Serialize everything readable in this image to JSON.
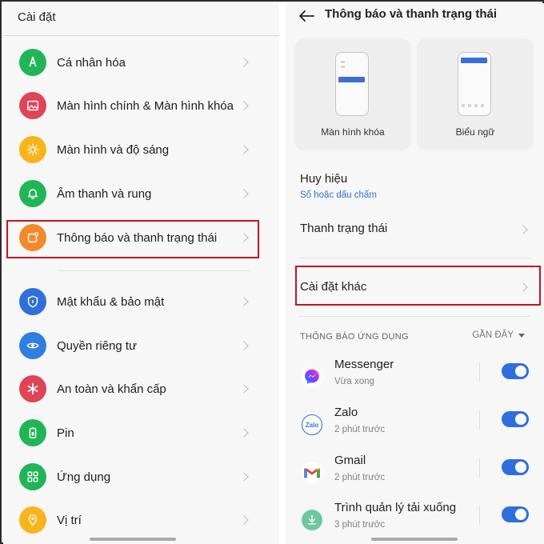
{
  "left": {
    "header": "Cài đặt",
    "items": [
      {
        "label": "Cá nhân hóa",
        "color": "#21b55a",
        "icon": "brush-icon"
      },
      {
        "label": "Màn hình chính & Màn hình khóa",
        "color": "#e04455",
        "icon": "image-icon"
      },
      {
        "label": "Màn hình và độ sáng",
        "color": "#f7b51b",
        "icon": "brightness-icon"
      },
      {
        "label": "Âm thanh và rung",
        "color": "#21b55a",
        "icon": "bell-icon"
      },
      {
        "label": "Thông báo và thanh trạng thái",
        "color": "#f08a2a",
        "icon": "notification-icon"
      },
      {
        "label": "Mật khẩu & bảo mật",
        "color": "#2f6fdb",
        "icon": "shield-icon"
      },
      {
        "label": "Quyền riêng tư",
        "color": "#2f7fe0",
        "icon": "privacy-eye-icon"
      },
      {
        "label": "An toàn và khẩn cấp",
        "color": "#e04455",
        "icon": "emergency-icon"
      },
      {
        "label": "Pin",
        "color": "#21b55a",
        "icon": "battery-icon"
      },
      {
        "label": "Ứng dụng",
        "color": "#21b55a",
        "icon": "apps-grid-icon"
      },
      {
        "label": "Vị trí",
        "color": "#f7b51b",
        "icon": "location-icon"
      }
    ]
  },
  "right": {
    "title": "Thông báo và thanh trạng thái",
    "cards": [
      {
        "label": "Màn hình khóa"
      },
      {
        "label": "Biểu ngữ"
      }
    ],
    "badge_title": "Huy hiệu",
    "badge_sub": "Số hoặc dấu chấm",
    "status_bar": "Thanh trạng thái",
    "more_settings": "Cài đặt khác",
    "section_header": "THÔNG BÁO ỨNG DỤNG",
    "sort_label": "GẦN ĐÂY",
    "apps": [
      {
        "name": "Messenger",
        "time": "Vừa xong",
        "enabled": true
      },
      {
        "name": "Zalo",
        "time": "2 phút trước",
        "enabled": true,
        "icon_text": "Zalo"
      },
      {
        "name": "Gmail",
        "time": "2 phút trước",
        "enabled": true
      },
      {
        "name": "Trình quản lý tải xuống",
        "time": "3 phút trước",
        "enabled": true
      }
    ],
    "accent": "#2f6fdb"
  }
}
